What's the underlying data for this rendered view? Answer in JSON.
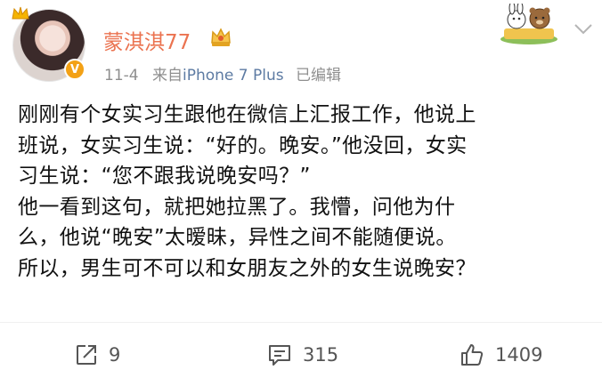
{
  "post": {
    "username": "蒙淇淇77",
    "date": "11-4",
    "source_prefix": "来自",
    "device": "iPhone 7 Plus",
    "edited": "已编辑",
    "lines": [
      "刚刚有个女实习生跟他在微信上汇报工作，他说上",
      "班说，女实习生说：“好的。晚安。”他没回，女实",
      "习生说：“您不跟我说晚安吗？”",
      "他一看到这句，就把她拉黑了。我懵，问他为什",
      "么，他说“晚安”太暧昧，异性之间不能随便说。",
      "所以，男生可不可以和女朋友之外的女生说晚安？"
    ]
  },
  "actions": {
    "repost_count": "9",
    "comment_count": "315",
    "like_count": "1409"
  },
  "icons": {
    "avatar_badge": "v-verified-icon",
    "crown": "crown-icon",
    "member_badge": "vip-crown-icon",
    "sticker": "bunny-bear-sticker-icon",
    "menu": "chevron-down-icon",
    "repost": "repost-icon",
    "comment": "comment-icon",
    "like": "thumbs-up-icon"
  },
  "colors": {
    "username": "#eb7350",
    "meta": "#8f8f8f",
    "device": "#5d7ba3",
    "verified_badge": "#f3a116"
  }
}
